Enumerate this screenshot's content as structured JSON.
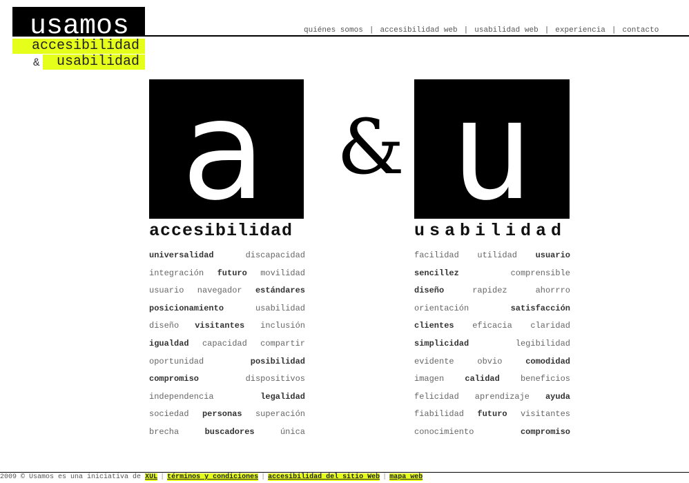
{
  "header": {
    "logo_text": "usamos",
    "tagline_1": "accesibilidad",
    "tagline_2_amp": "&",
    "tagline_2": "usabilidad"
  },
  "nav": [
    {
      "label": "quiénes somos"
    },
    {
      "label": "accesibilidad web"
    },
    {
      "label": "usabilidad web"
    },
    {
      "label": "experiencia"
    },
    {
      "label": "contacto"
    }
  ],
  "hero": {
    "letter_a": "a",
    "ampersand": "&",
    "letter_u": "u"
  },
  "accesibilidad": {
    "title": "accesibilidad",
    "rows": [
      [
        {
          "t": "universalidad",
          "b": true
        },
        {
          "t": "discapacidad",
          "b": false
        }
      ],
      [
        {
          "t": "integración",
          "b": false
        },
        {
          "t": "futuro",
          "b": true
        },
        {
          "t": "movilidad",
          "b": false
        }
      ],
      [
        {
          "t": "usuario",
          "b": false
        },
        {
          "t": "navegador",
          "b": false
        },
        {
          "t": "estándares",
          "b": true
        }
      ],
      [
        {
          "t": "posicionamiento",
          "b": true
        },
        {
          "t": "usabilidad",
          "b": false
        }
      ],
      [
        {
          "t": "diseño",
          "b": false
        },
        {
          "t": "visitantes",
          "b": true
        },
        {
          "t": "inclusión",
          "b": false
        }
      ],
      [
        {
          "t": "igualdad",
          "b": true
        },
        {
          "t": "capacidad",
          "b": false
        },
        {
          "t": "compartir",
          "b": false
        }
      ],
      [
        {
          "t": "oportunidad",
          "b": false
        },
        {
          "t": "posibilidad",
          "b": true
        }
      ],
      [
        {
          "t": "compromiso",
          "b": true
        },
        {
          "t": "dispositivos",
          "b": false
        }
      ],
      [
        {
          "t": "independencia",
          "b": false
        },
        {
          "t": "legalidad",
          "b": true
        }
      ],
      [
        {
          "t": "sociedad",
          "b": false
        },
        {
          "t": "personas",
          "b": true
        },
        {
          "t": "superación",
          "b": false
        }
      ],
      [
        {
          "t": "brecha",
          "b": false
        },
        {
          "t": "buscadores",
          "b": true
        },
        {
          "t": "única",
          "b": false
        }
      ]
    ]
  },
  "usabilidad": {
    "title": "usabilidad",
    "rows": [
      [
        {
          "t": "facilidad",
          "b": false
        },
        {
          "t": "utilidad",
          "b": false
        },
        {
          "t": "usuario",
          "b": true
        }
      ],
      [
        {
          "t": "sencillez",
          "b": true
        },
        {
          "t": "comprensible",
          "b": false
        }
      ],
      [
        {
          "t": "diseño",
          "b": true
        },
        {
          "t": "rapidez",
          "b": false
        },
        {
          "t": "ahorrro",
          "b": false
        }
      ],
      [
        {
          "t": "orientación",
          "b": false
        },
        {
          "t": "satisfacción",
          "b": true
        }
      ],
      [
        {
          "t": "clientes",
          "b": true
        },
        {
          "t": "eficacia",
          "b": false
        },
        {
          "t": "claridad",
          "b": false
        }
      ],
      [
        {
          "t": "simplicidad",
          "b": true
        },
        {
          "t": "legibilidad",
          "b": false
        }
      ],
      [
        {
          "t": "evidente",
          "b": false
        },
        {
          "t": "obvio",
          "b": false
        },
        {
          "t": "comodidad",
          "b": true
        }
      ],
      [
        {
          "t": "imagen",
          "b": false
        },
        {
          "t": "calidad",
          "b": true
        },
        {
          "t": "beneficios",
          "b": false
        }
      ],
      [
        {
          "t": "felicidad",
          "b": false
        },
        {
          "t": "aprendizaje",
          "b": false
        },
        {
          "t": "ayuda",
          "b": true
        }
      ],
      [
        {
          "t": "fiabilidad",
          "b": false
        },
        {
          "t": "futuro",
          "b": true
        },
        {
          "t": "visitantes",
          "b": false
        }
      ],
      [
        {
          "t": "conocimiento",
          "b": false
        },
        {
          "t": "compromiso",
          "b": true
        }
      ]
    ]
  },
  "footer": {
    "prefix": "2009 © Usamos es una iniciativa de",
    "links": [
      {
        "label": "XUL"
      },
      {
        "label": "términos y condiciones"
      },
      {
        "label": "accesibilidad del sitio Web"
      },
      {
        "label": "mapa web"
      }
    ]
  },
  "colors": {
    "highlight": "#e6ff1a",
    "tile": "#000000"
  }
}
